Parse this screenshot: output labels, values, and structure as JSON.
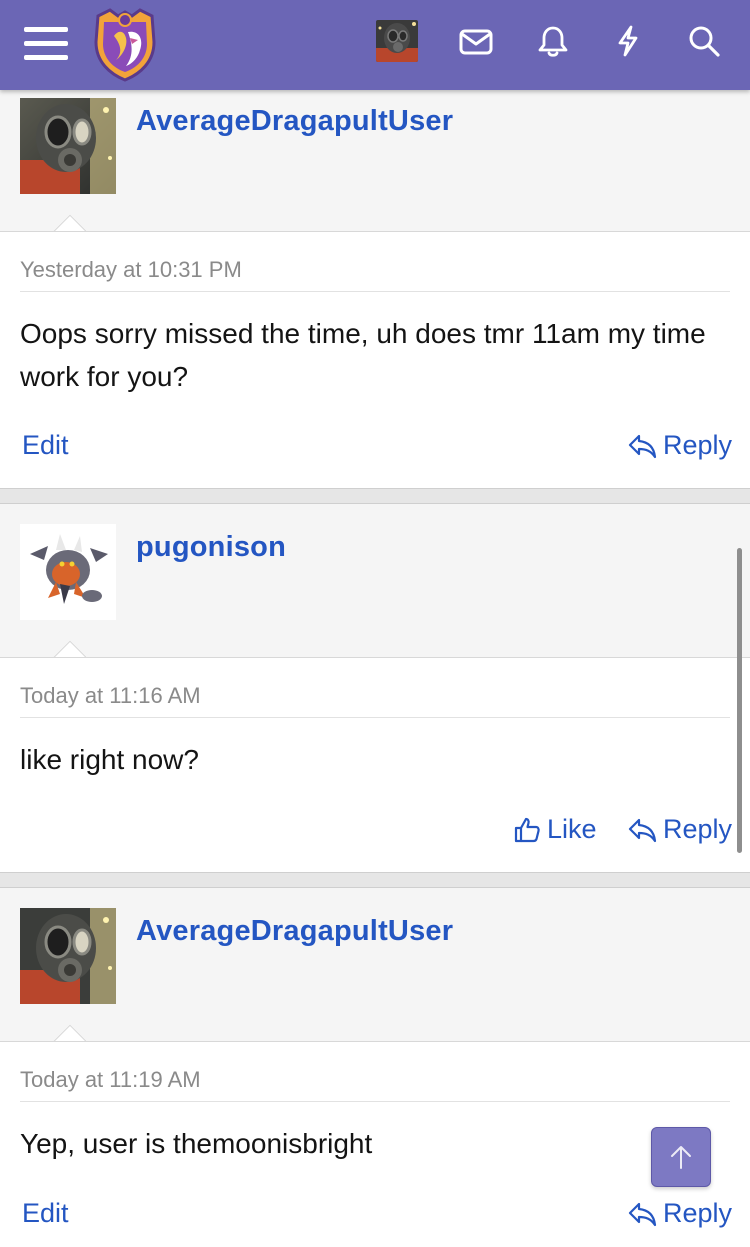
{
  "nav": {
    "menu_icon": "hamburger-menu-icon",
    "logo_icon": "forum-logo-shield",
    "avatar_icon": "gasmask-avatar",
    "icons": [
      "mail-icon",
      "bell-icon",
      "bolt-icon",
      "search-icon"
    ],
    "color": "#6b66b5"
  },
  "posts": [
    {
      "username": "AverageDragapultUser",
      "avatar": "gasmask-avatar",
      "date": "Yesterday at 10:31 PM",
      "message": "Oops sorry missed the time, uh does tmr 11am my time work for you?",
      "edit_label": "Edit",
      "reply_label": "Reply"
    },
    {
      "username": "pugonison",
      "avatar": "dragon-sprite-avatar",
      "date": "Today at 11:16 AM",
      "message": "like right now?",
      "like_label": "Like",
      "reply_label": "Reply"
    },
    {
      "username": "AverageDragapultUser",
      "avatar": "gasmask-avatar",
      "date": "Today at 11:19 AM",
      "message": "Yep, user is themoonisbright",
      "edit_label": "Edit",
      "reply_label": "Reply"
    }
  ],
  "colors": {
    "link": "#2456c2",
    "muted": "#8a8a8a",
    "back_to_top": "#7d79c3"
  }
}
